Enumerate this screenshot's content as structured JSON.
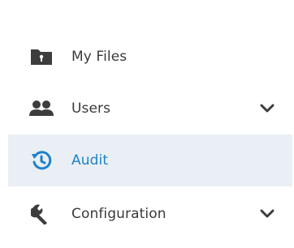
{
  "sidebar": {
    "items": [
      {
        "label": "My Files",
        "icon": "folder-lock-icon",
        "expandable": false,
        "active": false
      },
      {
        "label": "Users",
        "icon": "users-icon",
        "expandable": true,
        "active": false
      },
      {
        "label": "Audit",
        "icon": "history-icon",
        "expandable": false,
        "active": true
      },
      {
        "label": "Configuration",
        "icon": "wrench-icon",
        "expandable": true,
        "active": false
      }
    ]
  },
  "colors": {
    "icon": "#3d3d3d",
    "text": "#3a3a3a",
    "active_text": "#1e82c8",
    "active_background": "#e9eff4"
  }
}
